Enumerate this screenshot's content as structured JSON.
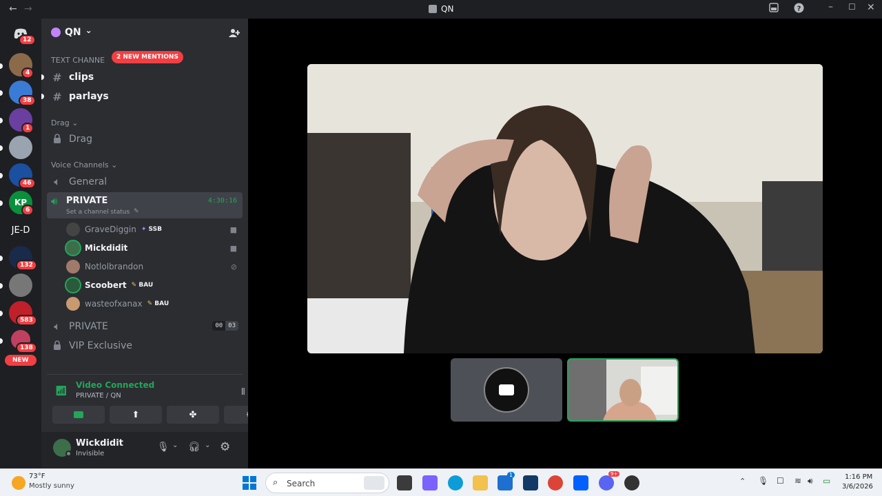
{
  "titlebar": {
    "back": "←",
    "forward": "→",
    "title": "QN"
  },
  "guilds": [
    {
      "label": "",
      "badge": "12",
      "color": "#5865f2",
      "name": "guild-home"
    },
    {
      "label": "",
      "badge": "4",
      "color": "#8b6a4a",
      "name": "guild-1"
    },
    {
      "label": "",
      "badge": "38",
      "color": "#3a7bd5",
      "name": "guild-2"
    },
    {
      "label": "",
      "badge": "1",
      "color": "#6a3fa0",
      "name": "guild-3"
    },
    {
      "label": "",
      "badge": "",
      "color": "#9aa4b0",
      "name": "guild-4"
    },
    {
      "label": "",
      "badge": "46",
      "color": "#1b4fa0",
      "name": "guild-5"
    },
    {
      "label": "KP",
      "badge": "6",
      "color": "#0a8f3c",
      "name": "guild-6"
    },
    {
      "label": "JE-D",
      "badge": "",
      "color": "#1e1f22",
      "name": "guild-7"
    },
    {
      "label": "",
      "badge": "132",
      "color": "#1a2a4a",
      "name": "guild-8"
    },
    {
      "label": "",
      "badge": "",
      "color": "#777",
      "name": "guild-9"
    },
    {
      "label": "",
      "badge": "583",
      "color": "#c0202a",
      "name": "guild-10"
    },
    {
      "label": "",
      "badge": "138",
      "color": "#c04060",
      "name": "guild-11"
    }
  ],
  "new_label": "NEW",
  "server": {
    "name": "QN",
    "chevron": "⌄"
  },
  "text_category": "TEXT CHANNE",
  "mentions": "2 NEW MENTIONS",
  "channels": {
    "clips": "clips",
    "parlays": "parlays"
  },
  "drag_category": "Drag",
  "drag_channel": "Drag",
  "voice_category": "Voice Channels",
  "voice_general": "General",
  "private_active": {
    "name": "PRIVATE",
    "timer": "4:30:16",
    "status": "Set a channel status"
  },
  "voice_users": [
    {
      "name": "GraveDiggin",
      "tag": "SSB",
      "color": "#444",
      "bright": false
    },
    {
      "name": "Mickdidit",
      "tag": "",
      "color": "#3c6e4a",
      "bright": true
    },
    {
      "name": "Notlolbrandon",
      "tag": "",
      "color": "#a07a6a",
      "bright": false
    },
    {
      "name": "Scoobert",
      "tag": "BAU",
      "color": "#2a5a3a",
      "bright": true
    },
    {
      "name": "wasteofxanax",
      "tag": "BAU",
      "color": "#c89a70",
      "bright": false
    }
  ],
  "private2": {
    "name": "PRIVATE",
    "count_a": "00",
    "count_b": "03"
  },
  "vip": "VIP Exclusive",
  "rtc": {
    "status": "Video Connected",
    "location": "PRIVATE / QN"
  },
  "user": {
    "name": "Wickdidit",
    "status": "Invisible"
  },
  "taskbar": {
    "temp": "73°F",
    "weather": "Mostly sunny",
    "search": "Search",
    "time": "1:16 PM",
    "date": "3/6/2026",
    "notif": "1",
    "discord_badge": "9+"
  }
}
